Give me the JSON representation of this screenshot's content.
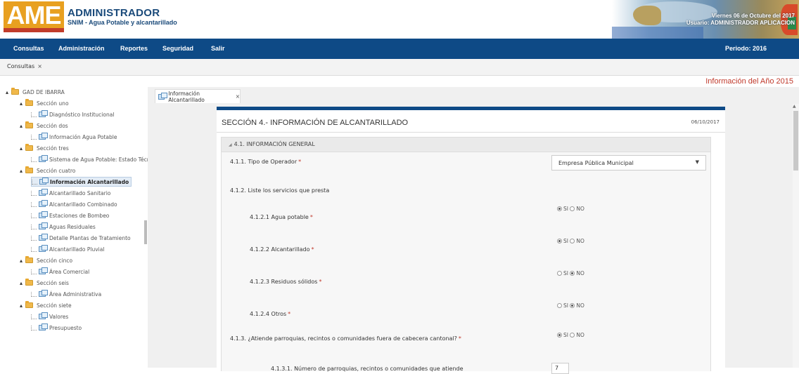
{
  "header": {
    "logo_text": "AME",
    "app_title": "ADMINISTRADOR",
    "app_subtitle": "SNIM - Agua Potable y alcantarillado",
    "date_line": "Viernes 06 de Octubre del 2017",
    "user_line": "Usuario: ADMINISTRADOR APLICACION"
  },
  "navbar": {
    "items": [
      "Consultas",
      "Administración",
      "Reportes",
      "Seguridad",
      "Salir"
    ],
    "periodo": "Periodo: 2016"
  },
  "tabs": {
    "consultas": "Consultas",
    "close": "×"
  },
  "info_year": "Información del Año 2015",
  "tree": {
    "root": "GAD DE IBARRA",
    "nodes": [
      "Sección uno",
      "Diagnóstico Institucional",
      "Sección dos",
      "Información Agua Potable",
      "Sección tres",
      "Sistema de Agua Potable: Estado Técn",
      "Sección cuatro",
      "Información Alcantarillado",
      "Alcantarillado Sanitario",
      "Alcantarillado Combinado",
      "Estaciones de Bombeo",
      "Aguas Residuales",
      "Detalle Plantas de Tratamiento",
      "Alcantarillado Pluvial",
      "Sección cinco",
      "Área Comercial",
      "Sección seis",
      "Área Administrativa",
      "Sección siete",
      "Valores",
      "Presupuesto"
    ]
  },
  "content_tab": {
    "label": "Información Alcantarillado",
    "close": "×"
  },
  "form": {
    "section_title": "SECCIÓN 4.- INFORMACIÓN DE ALCANTARILLADO",
    "date": "06/10/2017",
    "panel_title": "4.1. INFORMACIÓN GENERAL",
    "panel_toggle": "◢",
    "q_tipo": "4.1.1. Tipo de Operador",
    "tipo_value": "Empresa Pública Municipal",
    "q_servicios": "4.1.2. Liste los servicios que presta",
    "q_agua": "4.1.2.1 Agua potable",
    "q_alcant": "4.1.2.2 Alcantarillado",
    "q_residuos": "4.1.2.3 Residuos sólidos",
    "q_otros": "4.1.2.4 Otros",
    "q_atiende": "4.1.3. ¿Atiende parroquias, recintos o comunidades fuera de cabecera cantonal?",
    "q_numero": "4.1.3.1. Número de parroquias, recintos o comunidades que atiende",
    "numero_value": "7",
    "required_mark": "*",
    "si_label": "SI",
    "no_label": "NO",
    "radio_values": {
      "agua": "SI",
      "alcant": "SI",
      "residuos": "NO",
      "otros": "NO",
      "atiende": "SI"
    }
  },
  "colors": {
    "navbar": "#0e4a86",
    "info_year": "#c0392b",
    "required": "#c0392b",
    "logo": "#e8a020"
  }
}
